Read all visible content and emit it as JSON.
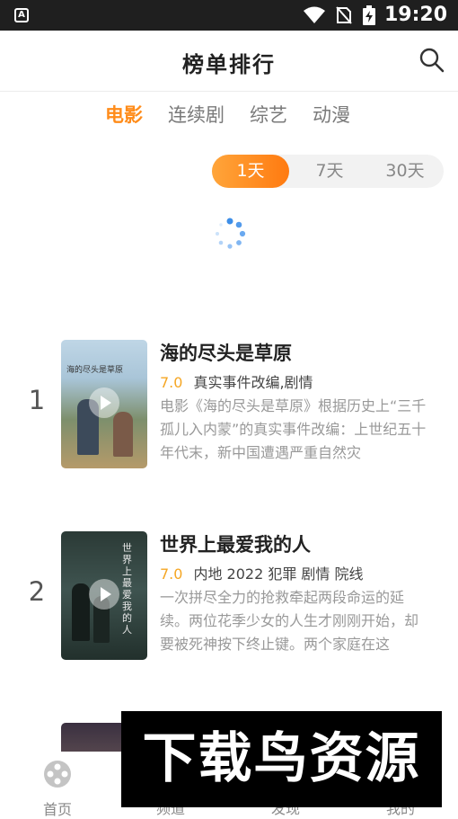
{
  "status_bar": {
    "time": "19:20",
    "notification_icon_text": "A",
    "icons": [
      "wifi-icon",
      "no-sim-icon",
      "battery-charging-icon"
    ]
  },
  "header": {
    "title": "榜单排行",
    "search_icon": "search-icon"
  },
  "tabs": [
    {
      "label": "电影",
      "active": true
    },
    {
      "label": "连续剧",
      "active": false
    },
    {
      "label": "综艺",
      "active": false
    },
    {
      "label": "动漫",
      "active": false
    }
  ],
  "time_range": {
    "options": [
      {
        "label": "1天",
        "active": true
      },
      {
        "label": "7天",
        "active": false
      },
      {
        "label": "30天",
        "active": false
      }
    ]
  },
  "loading_icon": "loading-spinner-icon",
  "rankings": [
    {
      "rank": "1",
      "title": "海的尽头是草原",
      "score": "7.0",
      "tags": "真实事件改编,剧情",
      "description": "电影《海的尽头是草原》根据历史上“三千孤儿入内蒙”的真实事件改编：上世纪五十年代末，新中国遭遇严重自然灾",
      "poster_text": "海的尽头是草原"
    },
    {
      "rank": "2",
      "title": "世界上最爱我的人",
      "score": "7.0",
      "tags": "内地 2022 犯罪 剧情 院线",
      "description": "一次拼尽全力的抢救牵起两段命运的延续。两位花季少女的人生才刚刚开始，却要被死神按下终止键。两个家庭在这",
      "poster_text": "世界上最爱我的人"
    }
  ],
  "bottom_nav": [
    {
      "label": "首页",
      "icon": "film-reel-icon",
      "active": true
    },
    {
      "label": "频道",
      "icon": "channel-icon",
      "active": false
    },
    {
      "label": "发现",
      "icon": "discover-icon",
      "active": false
    },
    {
      "label": "我的",
      "icon": "profile-icon",
      "active": false
    }
  ],
  "watermark": "下载鸟资源",
  "colors": {
    "accent": "#ff8c1a",
    "score": "#f5a623",
    "status_bar": "#1f1f1f"
  }
}
